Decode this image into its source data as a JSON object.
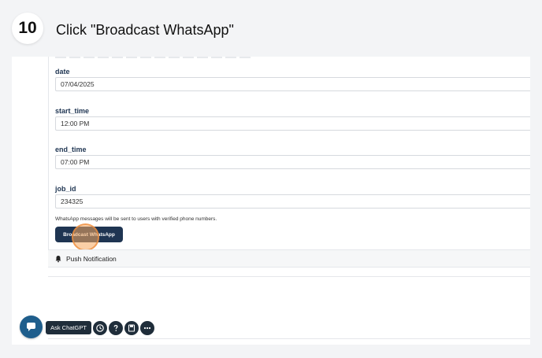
{
  "step": {
    "number": "10",
    "title": "Click \"Broadcast WhatsApp\""
  },
  "form": {
    "fields": [
      {
        "label": "date",
        "value": "07/04/2025"
      },
      {
        "label": "start_time",
        "value": "12:00 PM"
      },
      {
        "label": "end_time",
        "value": "07:00 PM"
      },
      {
        "label": "job_id",
        "value": "234325"
      }
    ],
    "note": "WhatsApp messages will be sent to users with verified phone numbers.",
    "broadcast_label": "Broadcast WhatsApp"
  },
  "push_notification": {
    "label": "Push Notification",
    "icon": "bell-icon"
  },
  "toolbar": {
    "ask_label": "Ask ChatGPT",
    "icons": [
      "chat-bubble-icon",
      "history-icon",
      "help-icon",
      "save-icon",
      "more-icon"
    ]
  },
  "colors": {
    "primary": "#1f3552",
    "click_marker": "#f6a85e",
    "chat_button": "#1f5e8c"
  }
}
